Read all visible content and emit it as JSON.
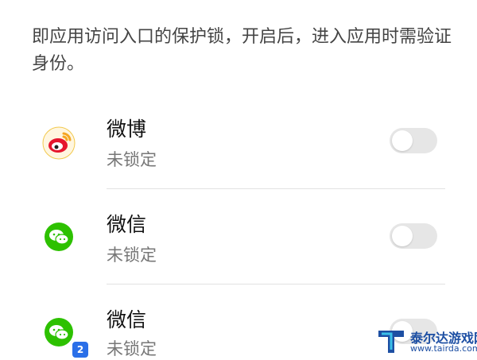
{
  "description": "即应用访问入口的保护锁，开启后，进入应用时需验证身份。",
  "apps": [
    {
      "name": "微博",
      "status": "未锁定",
      "icon": "weibo-icon",
      "locked": false
    },
    {
      "name": "微信",
      "status": "未锁定",
      "icon": "wechat-icon",
      "locked": false
    },
    {
      "name": "微信",
      "status": "未锁定",
      "icon": "wechat-clone-icon",
      "locked": false
    }
  ],
  "clone_badge": "2",
  "watermark": {
    "title": "泰尔达游戏网",
    "url": "www.tairda.com"
  },
  "colors": {
    "wechat_green": "#2dc100",
    "weibo_red": "#e6162d",
    "weibo_yellow": "#f5a623",
    "toggle_off": "#e6e6e6",
    "clone_badge": "#2a6fe8"
  }
}
